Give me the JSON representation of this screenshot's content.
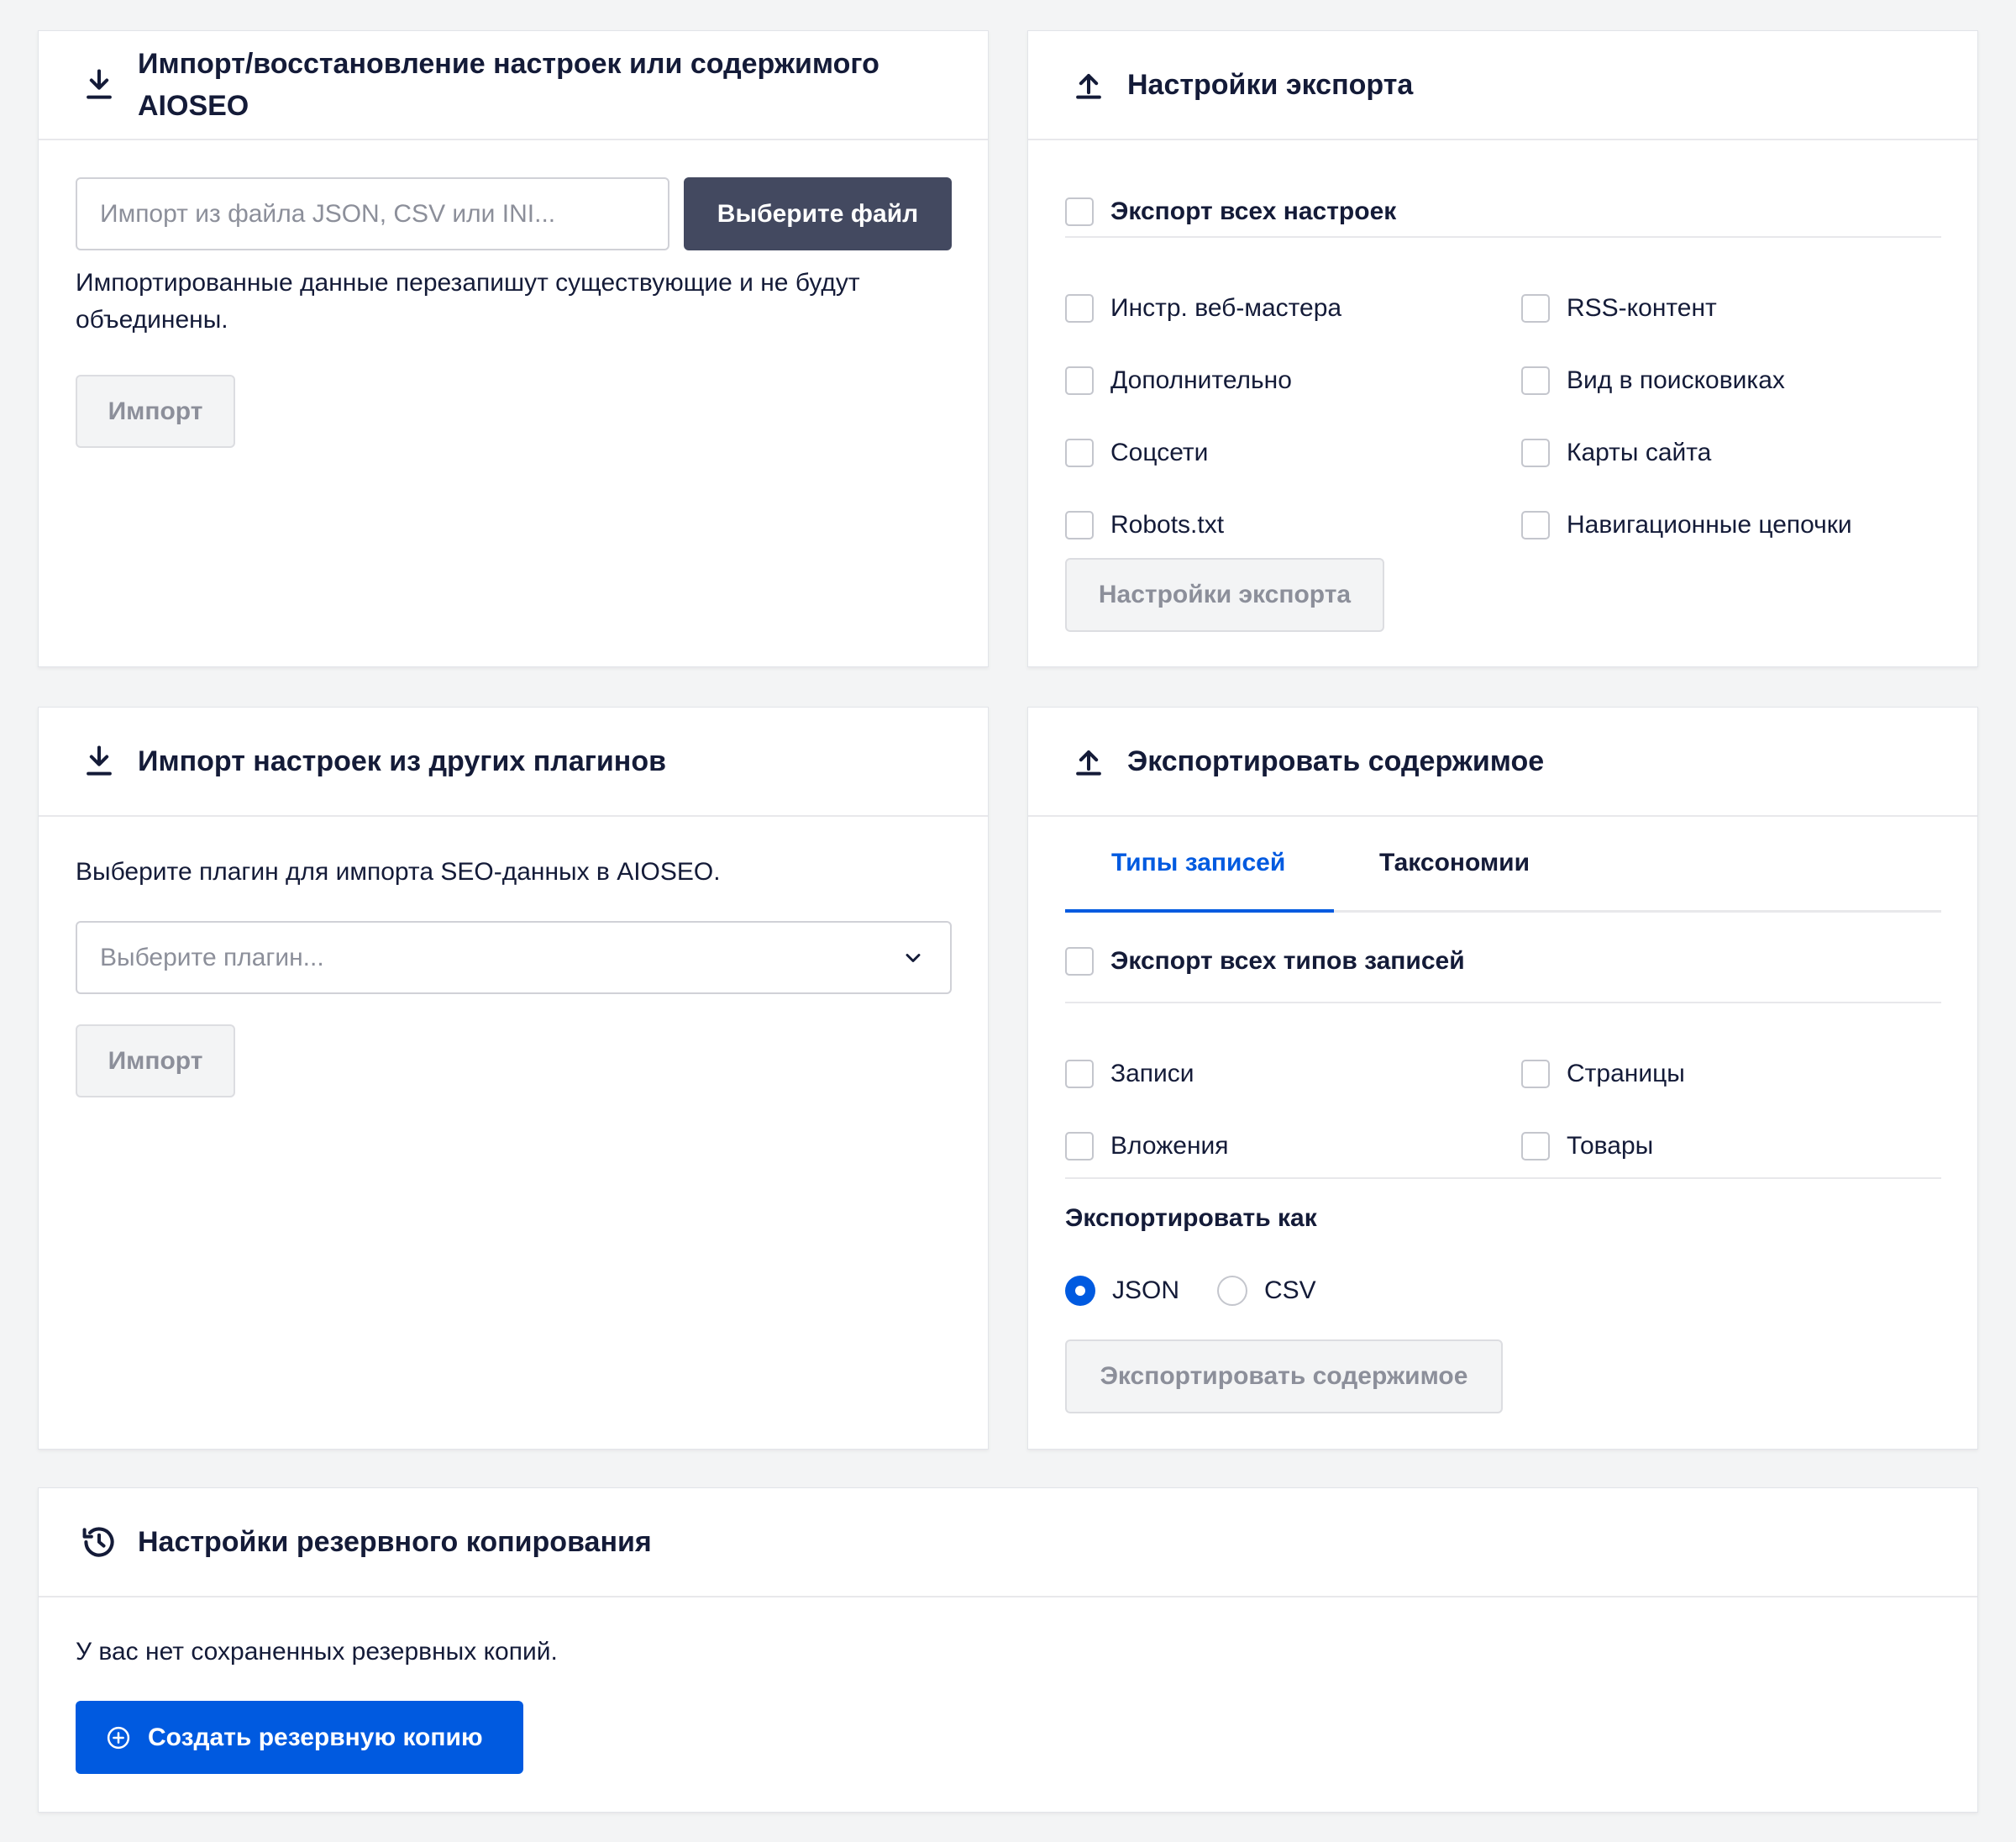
{
  "import_settings": {
    "title_line1": "Импорт/восстановление настроек или содержимого",
    "title_line2": "AIOSEO",
    "file_placeholder": "Импорт из файла JSON, CSV или INI...",
    "choose_file_label": "Выберите файл",
    "note_line1": "Импортированные данные перезапишут существующие и не будут",
    "note_line2": "объединены.",
    "import_button": "Импорт"
  },
  "export_settings": {
    "title": "Настройки экспорта",
    "export_all_label": "Экспорт всех настроек",
    "options_col1": [
      "Инстр. веб-мастера",
      "Дополнительно",
      "Соцсети",
      "Robots.txt"
    ],
    "options_col2": [
      "RSS-контент",
      "Вид в поисковиках",
      "Карты сайта",
      "Навигационные цепочки"
    ],
    "export_button": "Настройки экспорта"
  },
  "import_plugins": {
    "title": "Импорт настроек из других плагинов",
    "description": "Выберите плагин для импорта SEO-данных в AIOSEO.",
    "select_placeholder": "Выберите плагин...",
    "import_button": "Импорт"
  },
  "export_content": {
    "title": "Экспортировать содержимое",
    "tabs": [
      "Типы записей",
      "Таксономии"
    ],
    "active_tab": "Типы записей",
    "export_all_label": "Экспорт всех типов записей",
    "types_col1": [
      "Записи",
      "Вложения"
    ],
    "types_col2": [
      "Страницы",
      "Товары"
    ],
    "export_as_label": "Экспортировать как",
    "formats": [
      "JSON",
      "CSV"
    ],
    "selected_format": "JSON",
    "export_button": "Экспортировать содержимое"
  },
  "backup": {
    "title": "Настройки резервного копирования",
    "empty_text": "У вас нет сохраненных резервных копий.",
    "create_button": "Создать резервную копию"
  },
  "colors": {
    "accent": "#005ae0",
    "dark_button": "#434960",
    "text": "#141b38",
    "background": "#f3f4f5"
  }
}
